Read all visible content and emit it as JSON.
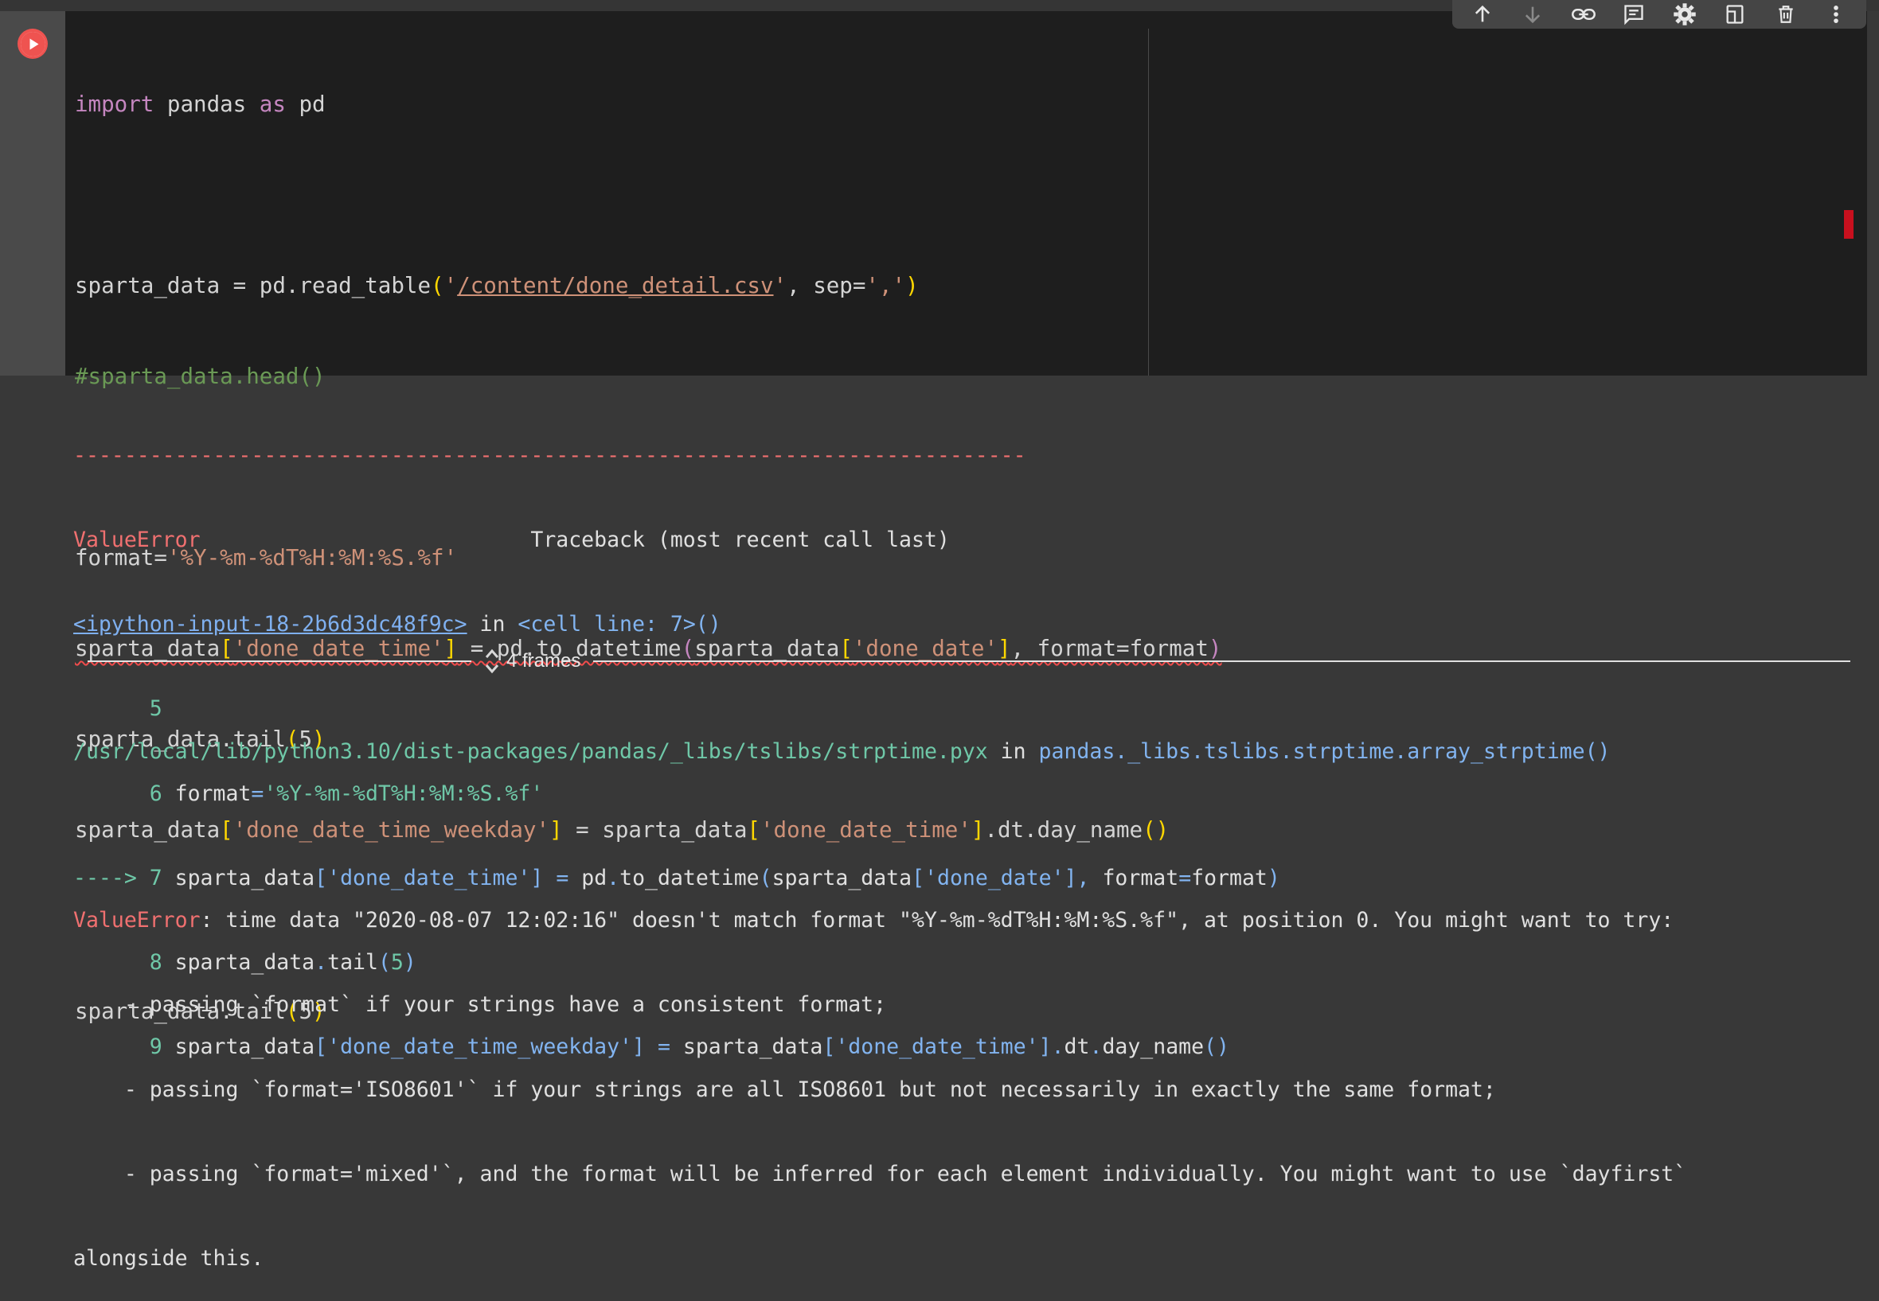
{
  "toolbar": {
    "buttons": [
      {
        "icon": "arrow-up-icon",
        "label": "Move cell up"
      },
      {
        "icon": "arrow-down-icon",
        "label": "Move cell down"
      },
      {
        "icon": "link-icon",
        "label": "Copy link to cell"
      },
      {
        "icon": "comment-icon",
        "label": "Add comment"
      },
      {
        "icon": "gear-icon",
        "label": "Open editor settings"
      },
      {
        "icon": "mirror-cell-icon",
        "label": "Mirror cell in tab"
      },
      {
        "icon": "trash-icon",
        "label": "Delete cell"
      },
      {
        "icon": "more-vert-icon",
        "label": "More cell actions"
      }
    ]
  },
  "cell": {
    "run_icon": "play-circle-icon",
    "code": {
      "l1": {
        "kw1": "import",
        "mod": " pandas ",
        "kw2": "as",
        "alias": " pd"
      },
      "l3": {
        "a": "sparta_data = pd.read_table",
        "o": "(",
        "q1": "'",
        "path": "/content/done_detail.csv",
        "q2": "'",
        "mid": ", sep=",
        "sep": "','",
        "c": ")"
      },
      "l4": "#sparta_data.head()",
      "l6": {
        "a": "format=",
        "s": "'%Y-%m-%dT%H:%M:%S.%f'"
      },
      "l7": {
        "a": "sparta_data",
        "b1": "[",
        "key": "'done_date_time'",
        "b2": "]",
        "m": " = pd.to_datetime",
        "p1": "(",
        "inner": "sparta_data",
        "b3": "[",
        "key2": "'done_date'",
        "b4": "]",
        "rest": ", format=format",
        "p2": ")"
      },
      "l8": {
        "a": "sparta_data.tail",
        "p1": "(",
        "n": "5",
        "p2": ")"
      },
      "l9": {
        "a": "sparta_data",
        "b1": "[",
        "key": "'done_date_time_weekday'",
        "b2": "]",
        "m": " = sparta_data",
        "b3": "[",
        "key2": "'done_date_time'",
        "b4": "]",
        "rest": ".dt.day_name",
        "p": "()"
      },
      "l11": {
        "a": "sparta_data.tail",
        "p1": "(",
        "n": "5",
        "p2": ")"
      }
    }
  },
  "output": {
    "dashes": "---------------------------------------------------------------------------",
    "err_name": "ValueError",
    "tb_header": "                          Traceback (most recent call last)",
    "input_link": "<ipython-input-18-2b6d3dc48f9c>",
    "in_word": " in ",
    "cell_line": "<cell line: 7>()",
    "tb": {
      "l5": {
        "num": "      5"
      },
      "l6": {
        "num": "      6",
        "a": " format",
        "eq": "=",
        "s": "'%Y-%m-%dT%H:%M:%S.%f'"
      },
      "l7": {
        "arrow": "----> 7",
        "a": " sparta_data",
        "b1": "[",
        "key": "'done_date_time'",
        "b2": "]",
        "eq": " =",
        "m": " pd",
        "dot": ".",
        "f": "to_datetime",
        "p1": "(",
        "inner": "sparta_data",
        "b3": "[",
        "key2": "'done_date'",
        "b4": "],",
        "sp": " ",
        "fw": "format",
        "eq2": "=",
        "fv": "format",
        "p2": ")"
      },
      "l8": {
        "num": "      8",
        "a": " sparta_data",
        "dot": ".",
        "f": "tail",
        "p1": "(",
        "n": "5",
        "p2": ")"
      },
      "l9": {
        "num": "      9",
        "a": " sparta_data",
        "b1": "[",
        "key": "'done_date_time_weekday'",
        "b2": "]",
        "eq": " =",
        "m": " sparta_data",
        "b3": "[",
        "key2": "'done_date_time'",
        "b4": "]",
        "dot1": ".",
        "dt": "dt",
        "dot2": ".",
        "f": "day_name",
        "p": "()"
      }
    },
    "frames_label": "4 frames",
    "frames_icon": "unfold-icon",
    "lib_path": "/usr/local/lib/python3.10/dist-packages/pandas/_libs/tslibs/strptime.pyx",
    "lib_in": " in ",
    "lib_func": "pandas._libs.tslibs.strptime.array_strptime()",
    "msg_name": "ValueError",
    "msg_1": ": time data \"2020-08-07 12:02:16\" doesn't match format \"%Y-%m-%dT%H:%M:%S.%f\", at position 0. You might want to try:",
    "msg_2": "    - passing `format` if your strings have a consistent format;",
    "msg_3": "    - passing `format='ISO8601'` if your strings are all ISO8601 but not necessarily in exactly the same format;",
    "msg_4": "    - passing `format='mixed'`, and the format will be inferred for each element individually. You might want to use `dayfirst`",
    "msg_5": "alongside this."
  }
}
